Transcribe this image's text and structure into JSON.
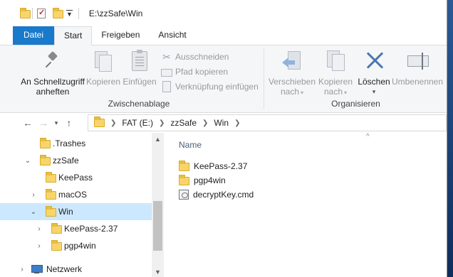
{
  "window": {
    "title": "E:\\zzSafe\\Win"
  },
  "ribbon": {
    "tabs": [
      {
        "label": "Datei"
      },
      {
        "label": "Start"
      },
      {
        "label": "Freigeben"
      },
      {
        "label": "Ansicht"
      }
    ],
    "clipboard": {
      "group_label": "Zwischenablage",
      "pin_label_line1": "An Schnellzugriff",
      "pin_label_line2": "anheften",
      "copy_label": "Kopieren",
      "paste_label": "Einfügen",
      "cut_label": "Ausschneiden",
      "copy_path_label": "Pfad kopieren",
      "paste_shortcut_label": "Verknüpfung einfügen"
    },
    "organize": {
      "group_label": "Organisieren",
      "move_label_line1": "Verschieben",
      "move_label_line2": "nach",
      "copyto_label_line1": "Kopieren",
      "copyto_label_line2": "nach",
      "delete_label": "Löschen",
      "rename_label": "Umbenennen"
    }
  },
  "address": {
    "crumbs": [
      "FAT (E:)",
      "zzSafe",
      "Win"
    ]
  },
  "nav": {
    "items": [
      {
        "label": ".Trashes"
      },
      {
        "label": "zzSafe"
      },
      {
        "label": "KeePass"
      },
      {
        "label": "macOS"
      },
      {
        "label": "Win"
      },
      {
        "label": "KeePass-2.37"
      },
      {
        "label": "pgp4win"
      },
      {
        "label": "Netzwerk"
      }
    ]
  },
  "content": {
    "column_name": "Name",
    "files": [
      {
        "name": "KeePass-2.37",
        "type": "folder"
      },
      {
        "name": "pgp4win",
        "type": "folder"
      },
      {
        "name": "decryptKey.cmd",
        "type": "cmd"
      }
    ]
  },
  "colors": {
    "accent": "#1979ca",
    "selection": "#cce8ff",
    "folder": "#f7d56a"
  }
}
